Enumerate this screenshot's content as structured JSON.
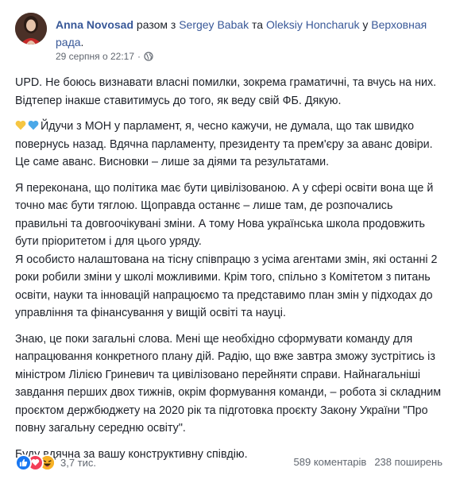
{
  "header": {
    "author": "Anna Novosad",
    "with_text": "разом з",
    "tagged_1": "Sergey Babak",
    "and_text": "та",
    "tagged_2": "Oleksiy Honcharuk",
    "at_text": "у",
    "location": "Верховная рада",
    "period": ".",
    "timestamp": "29 серпня о 22:17",
    "separator": "·",
    "privacy_icon": "globe-icon"
  },
  "body": {
    "p1": "UPD. Не боюсь визнавати власні помилки, зокрема граматичні, та вчусь на них. Відтепер інакше ставитимусь до того, як веду свій ФБ. Дякую.",
    "p2_emoji": [
      "yellow-heart",
      "blue-heart"
    ],
    "p2": "Йдучи з МОН у парламент, я, чесно кажучи, не думала, що так швидко повернусь назад. Вдячна парламенту, президенту та прем'єру за аванс довіри. Це саме аванс. Висновки – лише за діями та результатами.",
    "p3a": "Я переконана, що політика має бути цивілізованою. А у сфері освіти вона ще й точно має бути тяглою. Щоправда останнє – лише там, де розпочались правильні та довгоочікувані зміни. А тому Нова українська школа продовжить бути пріоритетом і для цього уряду.",
    "p3b": "Я особисто налаштована на тісну співпрацю з усіма агентами змін, які останні 2 роки робили зміни у школі можливими. Крім того, спільно з Комітетом з питань освіти, науки та інновацій напрацюємо та представимо план змін у підходах до управління та фінансування у вищій освіті та науці.",
    "p4": "Знаю, це поки загальні слова. Мені ще необхідно сформувати команду для напрацювання конкретного плану дій. Радію, що вже завтра зможу зустрітись із міністром Лілією Гриневич та цивілізовано перейняти справи. Найнагальніші завдання перших двох тижнів, окрім формування команди, – робота зі складним проєктом держбюджету на 2020 рік та підготовка проєкту Закону України \"Про повну загальну середню освіту\".",
    "p5": "Буду вдячна за вашу конструктивну співдію."
  },
  "footer": {
    "reactions": [
      "like-icon",
      "love-icon",
      "haha-icon"
    ],
    "reaction_count": "3,7 тис.",
    "comments": "589 коментарів",
    "shares": "238 поширень"
  },
  "colors": {
    "link": "#385898",
    "text": "#1d2129",
    "meta": "#616770",
    "like": "#1877f2",
    "love": "#f33e58",
    "haha": "#f7b125"
  }
}
